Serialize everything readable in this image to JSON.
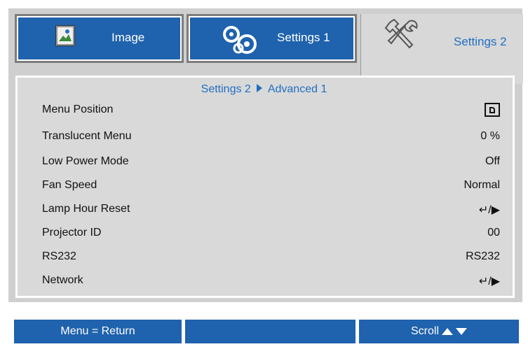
{
  "tabs": {
    "image": "Image",
    "settings1": "Settings 1",
    "settings2": "Settings 2"
  },
  "breadcrumb": {
    "parent": "Settings 2",
    "separator_icon": "triangle-right",
    "current": "Advanced 1"
  },
  "menu": {
    "items": [
      {
        "label": "Menu Position",
        "value": "",
        "value_icon": "position-icon"
      },
      {
        "label": "Translucent Menu",
        "value": "0 %"
      },
      {
        "label": "Low Power Mode",
        "value": "Off"
      },
      {
        "label": "Fan Speed",
        "value": "Normal"
      },
      {
        "label": "Lamp Hour Reset",
        "value": "↵/▶"
      },
      {
        "label": "Projector ID",
        "value": "00"
      },
      {
        "label": "RS232",
        "value": "RS232"
      },
      {
        "label": "Network",
        "value": "↵/▶"
      }
    ]
  },
  "footer": {
    "left": "Menu = Return",
    "middle": "",
    "right": "Scroll"
  },
  "colors": {
    "blue": "#1f62ad",
    "accent_text": "#1f6fc0",
    "panel": "#d9d9d9",
    "frame": "#cfcfcf"
  }
}
